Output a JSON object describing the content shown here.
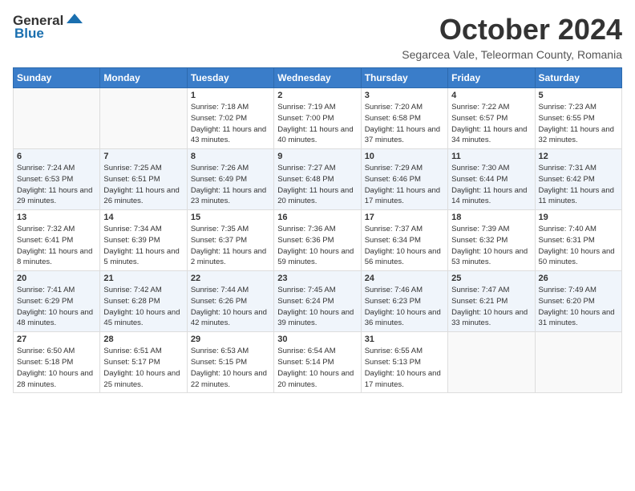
{
  "header": {
    "logo_general": "General",
    "logo_blue": "Blue",
    "month_title": "October 2024",
    "subtitle": "Segarcea Vale, Teleorman County, Romania"
  },
  "days_of_week": [
    "Sunday",
    "Monday",
    "Tuesday",
    "Wednesday",
    "Thursday",
    "Friday",
    "Saturday"
  ],
  "weeks": [
    [
      {
        "day": "",
        "info": ""
      },
      {
        "day": "",
        "info": ""
      },
      {
        "day": "1",
        "info": "Sunrise: 7:18 AM\nSunset: 7:02 PM\nDaylight: 11 hours and 43 minutes."
      },
      {
        "day": "2",
        "info": "Sunrise: 7:19 AM\nSunset: 7:00 PM\nDaylight: 11 hours and 40 minutes."
      },
      {
        "day": "3",
        "info": "Sunrise: 7:20 AM\nSunset: 6:58 PM\nDaylight: 11 hours and 37 minutes."
      },
      {
        "day": "4",
        "info": "Sunrise: 7:22 AM\nSunset: 6:57 PM\nDaylight: 11 hours and 34 minutes."
      },
      {
        "day": "5",
        "info": "Sunrise: 7:23 AM\nSunset: 6:55 PM\nDaylight: 11 hours and 32 minutes."
      }
    ],
    [
      {
        "day": "6",
        "info": "Sunrise: 7:24 AM\nSunset: 6:53 PM\nDaylight: 11 hours and 29 minutes."
      },
      {
        "day": "7",
        "info": "Sunrise: 7:25 AM\nSunset: 6:51 PM\nDaylight: 11 hours and 26 minutes."
      },
      {
        "day": "8",
        "info": "Sunrise: 7:26 AM\nSunset: 6:49 PM\nDaylight: 11 hours and 23 minutes."
      },
      {
        "day": "9",
        "info": "Sunrise: 7:27 AM\nSunset: 6:48 PM\nDaylight: 11 hours and 20 minutes."
      },
      {
        "day": "10",
        "info": "Sunrise: 7:29 AM\nSunset: 6:46 PM\nDaylight: 11 hours and 17 minutes."
      },
      {
        "day": "11",
        "info": "Sunrise: 7:30 AM\nSunset: 6:44 PM\nDaylight: 11 hours and 14 minutes."
      },
      {
        "day": "12",
        "info": "Sunrise: 7:31 AM\nSunset: 6:42 PM\nDaylight: 11 hours and 11 minutes."
      }
    ],
    [
      {
        "day": "13",
        "info": "Sunrise: 7:32 AM\nSunset: 6:41 PM\nDaylight: 11 hours and 8 minutes."
      },
      {
        "day": "14",
        "info": "Sunrise: 7:34 AM\nSunset: 6:39 PM\nDaylight: 11 hours and 5 minutes."
      },
      {
        "day": "15",
        "info": "Sunrise: 7:35 AM\nSunset: 6:37 PM\nDaylight: 11 hours and 2 minutes."
      },
      {
        "day": "16",
        "info": "Sunrise: 7:36 AM\nSunset: 6:36 PM\nDaylight: 10 hours and 59 minutes."
      },
      {
        "day": "17",
        "info": "Sunrise: 7:37 AM\nSunset: 6:34 PM\nDaylight: 10 hours and 56 minutes."
      },
      {
        "day": "18",
        "info": "Sunrise: 7:39 AM\nSunset: 6:32 PM\nDaylight: 10 hours and 53 minutes."
      },
      {
        "day": "19",
        "info": "Sunrise: 7:40 AM\nSunset: 6:31 PM\nDaylight: 10 hours and 50 minutes."
      }
    ],
    [
      {
        "day": "20",
        "info": "Sunrise: 7:41 AM\nSunset: 6:29 PM\nDaylight: 10 hours and 48 minutes."
      },
      {
        "day": "21",
        "info": "Sunrise: 7:42 AM\nSunset: 6:28 PM\nDaylight: 10 hours and 45 minutes."
      },
      {
        "day": "22",
        "info": "Sunrise: 7:44 AM\nSunset: 6:26 PM\nDaylight: 10 hours and 42 minutes."
      },
      {
        "day": "23",
        "info": "Sunrise: 7:45 AM\nSunset: 6:24 PM\nDaylight: 10 hours and 39 minutes."
      },
      {
        "day": "24",
        "info": "Sunrise: 7:46 AM\nSunset: 6:23 PM\nDaylight: 10 hours and 36 minutes."
      },
      {
        "day": "25",
        "info": "Sunrise: 7:47 AM\nSunset: 6:21 PM\nDaylight: 10 hours and 33 minutes."
      },
      {
        "day": "26",
        "info": "Sunrise: 7:49 AM\nSunset: 6:20 PM\nDaylight: 10 hours and 31 minutes."
      }
    ],
    [
      {
        "day": "27",
        "info": "Sunrise: 6:50 AM\nSunset: 5:18 PM\nDaylight: 10 hours and 28 minutes."
      },
      {
        "day": "28",
        "info": "Sunrise: 6:51 AM\nSunset: 5:17 PM\nDaylight: 10 hours and 25 minutes."
      },
      {
        "day": "29",
        "info": "Sunrise: 6:53 AM\nSunset: 5:15 PM\nDaylight: 10 hours and 22 minutes."
      },
      {
        "day": "30",
        "info": "Sunrise: 6:54 AM\nSunset: 5:14 PM\nDaylight: 10 hours and 20 minutes."
      },
      {
        "day": "31",
        "info": "Sunrise: 6:55 AM\nSunset: 5:13 PM\nDaylight: 10 hours and 17 minutes."
      },
      {
        "day": "",
        "info": ""
      },
      {
        "day": "",
        "info": ""
      }
    ]
  ]
}
